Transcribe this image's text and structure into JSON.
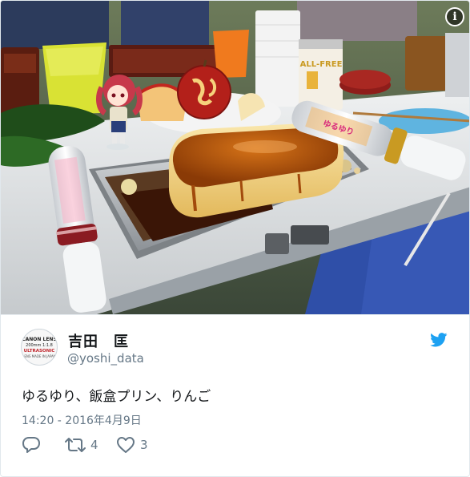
{
  "photo": {
    "alt": "Photo",
    "info_icon": "info-icon",
    "can_label": "ALL-FREE",
    "box_label": "ゆるゆり"
  },
  "author": {
    "display_name": "吉田　匡",
    "handle": "@yoshi_data",
    "avatar_lines": [
      "CANON LENS",
      "200mm 1:1.8",
      "ULTRASONIC",
      "LENS MADE IN JAPAN"
    ]
  },
  "tweet": {
    "text": "ゆるゆり、飯盒プリン、りんご",
    "timestamp": "14:20 - 2016年4月9日"
  },
  "actions": {
    "reply_icon": "reply-icon",
    "retweet_icon": "retweet-icon",
    "retweet_count": "4",
    "like_icon": "heart-icon",
    "like_count": "3"
  },
  "colors": {
    "twitter_blue": "#1da1f2",
    "muted_text": "#657786",
    "pudding": "#f2d58a",
    "caramel": "#b0540f"
  }
}
